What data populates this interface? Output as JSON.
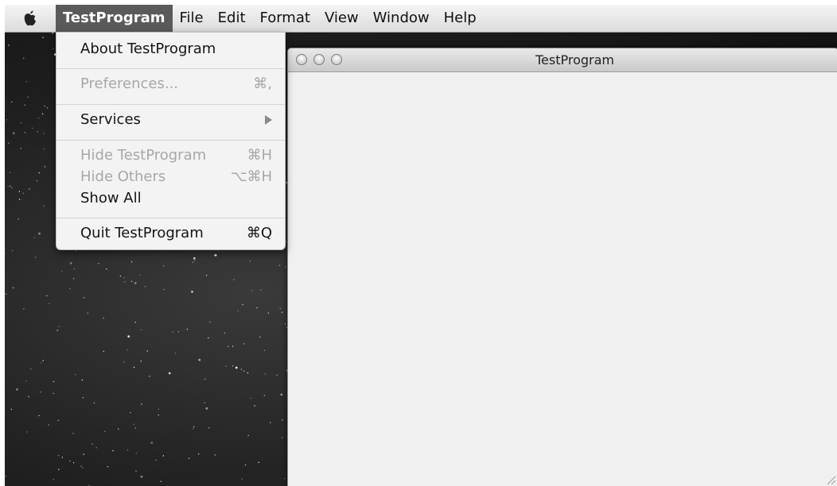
{
  "menubar": {
    "apple_icon": "apple-logo-icon",
    "menus": [
      {
        "label": "TestProgram",
        "active": true
      },
      {
        "label": "File"
      },
      {
        "label": "Edit"
      },
      {
        "label": "Format"
      },
      {
        "label": "View"
      },
      {
        "label": "Window"
      },
      {
        "label": "Help"
      }
    ]
  },
  "app_menu": {
    "items": [
      {
        "label": "About TestProgram",
        "shortcut": "",
        "enabled": true
      },
      {
        "label": "Preferences...",
        "shortcut": "⌘,",
        "enabled": false
      },
      {
        "label": "Services",
        "shortcut": "",
        "enabled": true,
        "submenu_icon": "submenu-arrow-icon"
      },
      {
        "label": "Hide TestProgram",
        "shortcut": "⌘H",
        "enabled": false
      },
      {
        "label": "Hide Others",
        "shortcut": "⌥⌘H",
        "enabled": false
      },
      {
        "label": "Show All",
        "shortcut": "",
        "enabled": true
      },
      {
        "label": "Quit TestProgram",
        "shortcut": "⌘Q",
        "enabled": true
      }
    ]
  },
  "window": {
    "title": "TestProgram",
    "buttons": [
      "close-button",
      "minimize-button",
      "zoom-button"
    ],
    "resize_icon": "resize-grip-icon"
  },
  "colors": {
    "menu_highlight": "#5a5a5a",
    "disabled_text": "#a7a7a7",
    "desktop": "#1e1e1e"
  }
}
